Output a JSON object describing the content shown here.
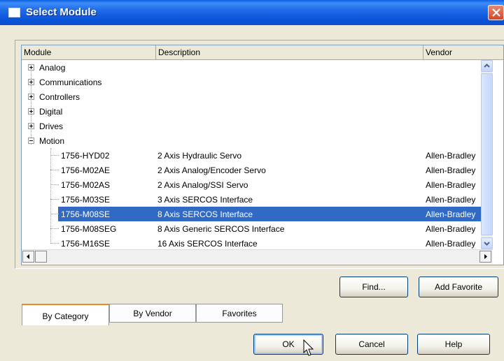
{
  "window": {
    "title": "Select Module"
  },
  "columns": {
    "module": "Module",
    "description": "Description",
    "vendor": "Vendor"
  },
  "categories": [
    "Analog",
    "Communications",
    "Controllers",
    "Digital",
    "Drives",
    "Motion"
  ],
  "motion_items": [
    {
      "module": "1756-HYD02",
      "description": "2 Axis Hydraulic Servo",
      "vendor": "Allen-Bradley"
    },
    {
      "module": "1756-M02AE",
      "description": "2 Axis Analog/Encoder Servo",
      "vendor": "Allen-Bradley"
    },
    {
      "module": "1756-M02AS",
      "description": "2 Axis Analog/SSI Servo",
      "vendor": "Allen-Bradley"
    },
    {
      "module": "1756-M03SE",
      "description": "3 Axis SERCOS Interface",
      "vendor": "Allen-Bradley"
    },
    {
      "module": "1756-M08SE",
      "description": "8 Axis SERCOS Interface",
      "vendor": "Allen-Bradley"
    },
    {
      "module": "1756-M08SEG",
      "description": "8 Axis Generic SERCOS Interface",
      "vendor": "Allen-Bradley"
    },
    {
      "module": "1756-M16SE",
      "description": "16 Axis SERCOS Interface",
      "vendor": "Allen-Bradley"
    }
  ],
  "selected_module": "1756-M08SE",
  "buttons": {
    "find": "Find...",
    "add_favorite": "Add Favorite",
    "ok": "OK",
    "cancel": "Cancel",
    "help": "Help"
  },
  "tabs": {
    "by_category": "By Category",
    "by_vendor": "By Vendor",
    "favorites": "Favorites"
  },
  "colors": {
    "selection": "#316ac5",
    "titlebar": "#0a5fe0",
    "dialog_bg": "#ece9d8"
  }
}
